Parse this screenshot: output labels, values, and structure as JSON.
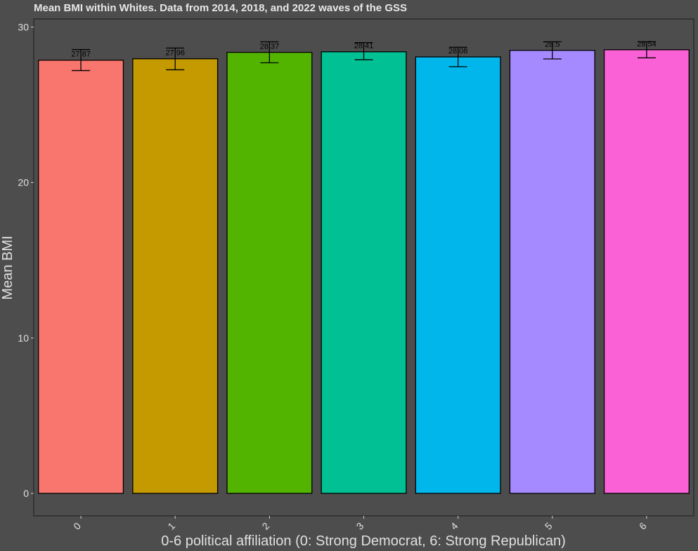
{
  "chart_data": {
    "type": "bar",
    "title": "Mean BMI within Whites. Data from 2014, 2018, and 2022 waves of the GSS",
    "xlabel": "0-6 political affiliation (0: Strong Democrat, 6: Strong Republican)",
    "ylabel": "Mean BMI",
    "ylim": [
      0,
      30.2
    ],
    "yticks": [
      "0",
      "10",
      "20",
      "30"
    ],
    "grid": false,
    "categories": [
      "0",
      "1",
      "2",
      "3",
      "4",
      "5",
      "6"
    ],
    "values": [
      27.87,
      27.96,
      28.37,
      28.41,
      28.08,
      28.5,
      28.54
    ],
    "labels": [
      "27.87",
      "27.96",
      "28.37",
      "28.41",
      "28.08",
      "28.5",
      "28.54"
    ],
    "error_low": [
      27.2,
      27.25,
      27.7,
      27.9,
      27.45,
      27.95,
      28.02
    ],
    "error_high": [
      28.55,
      28.65,
      29.05,
      29.0,
      28.7,
      29.05,
      29.05
    ],
    "colors": [
      "#F8766D",
      "#C49A00",
      "#53B400",
      "#00C094",
      "#00B6EB",
      "#A58AFF",
      "#FB61D7"
    ],
    "panel_color": "#4d4d4d"
  }
}
